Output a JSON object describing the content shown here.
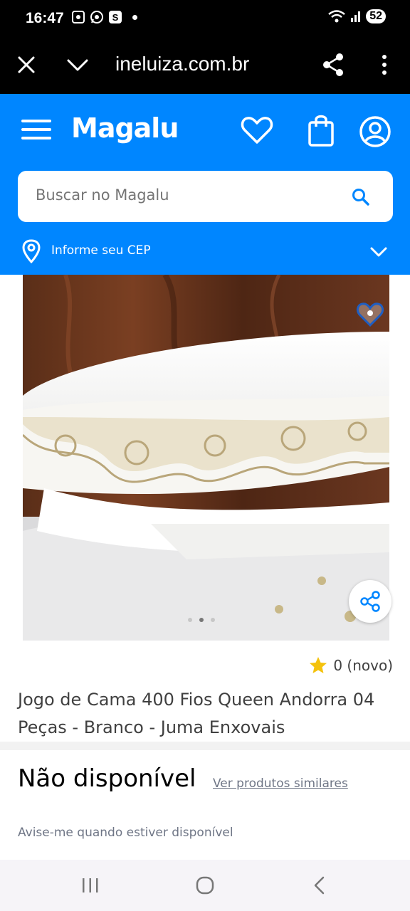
{
  "status_bar": {
    "time": "16:47",
    "battery": "52",
    "icons": [
      "screenshot-icon",
      "whatsapp-icon",
      "app-s-icon",
      "notification-dot",
      "wifi-icon",
      "signal-icon"
    ]
  },
  "browser": {
    "url": "ineluiza.com.br",
    "icons": [
      "close-icon",
      "chevron-down-icon",
      "share-icon",
      "more-vert-icon"
    ]
  },
  "header": {
    "logo": "Magalu",
    "search": {
      "placeholder": "Buscar no Magalu"
    },
    "cep_label": "Informe seu CEP",
    "brand_color": "#0086ff"
  },
  "product": {
    "rating_text": "0 (novo)",
    "title": "Jogo de Cama 400 Fios Queen Andorra 04 Peças - Branco - Juma Enxovais",
    "carousel": {
      "count": 3,
      "active": 1
    }
  },
  "availability": {
    "status": "Não disponível",
    "similar_link": "Ver produtos similares",
    "notify": "Avise-me quando estiver disponível"
  }
}
